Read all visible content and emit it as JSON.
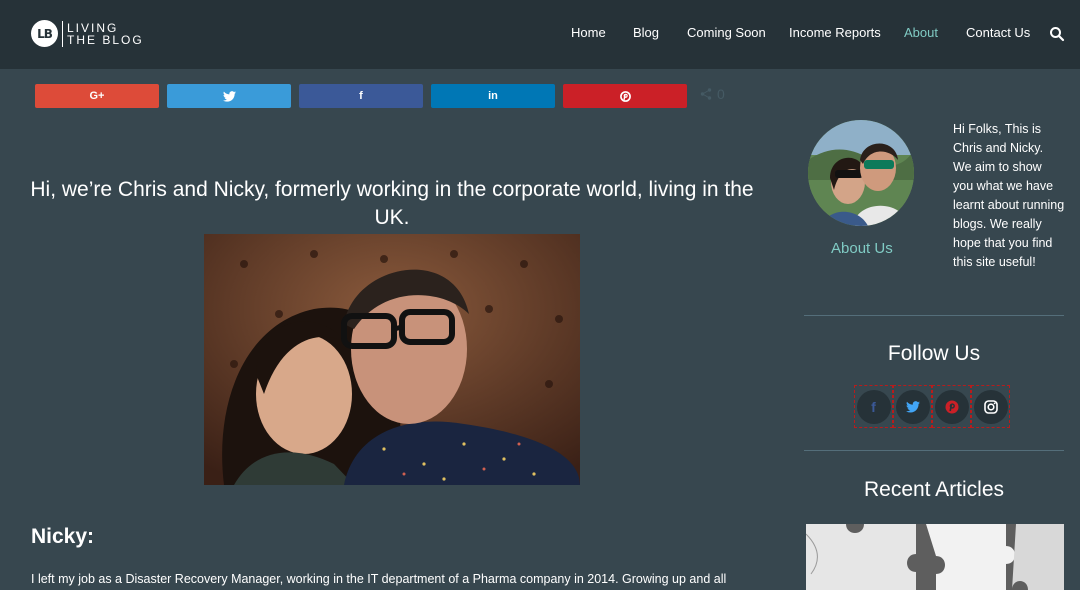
{
  "header": {
    "logo_badge": "LB",
    "logo_line1": "LIVING",
    "logo_line2": "THE BLOG",
    "nav": [
      {
        "label": "Home"
      },
      {
        "label": "Blog"
      },
      {
        "label": "Coming Soon"
      },
      {
        "label": "Income Reports"
      },
      {
        "label": "About"
      },
      {
        "label": "Contact Us"
      }
    ],
    "active_nav": "About",
    "search_icon": "search-icon"
  },
  "share": {
    "buttons": [
      {
        "network": "google-plus",
        "glyph": "G+",
        "color": "#dd4b39"
      },
      {
        "network": "twitter",
        "glyph": "twitter-icon",
        "color": "#3a9bd9"
      },
      {
        "network": "facebook",
        "glyph": "f",
        "color": "#3b5998"
      },
      {
        "network": "linkedin",
        "glyph": "in",
        "color": "#0077b5"
      },
      {
        "network": "pinterest",
        "glyph": "pinterest-icon",
        "color": "#cb2027"
      }
    ],
    "count": "0"
  },
  "main": {
    "intro": "Hi, we’re Chris and Nicky, formerly working in the corporate world, living in the UK.",
    "heading": "Nicky:",
    "paragraph": "I left my job as a Disaster Recovery Manager, working in the IT department of a Pharma company in 2014. Growing up and all"
  },
  "sidebar": {
    "about_link": "About Us",
    "about_text": "Hi Folks, This is Chris and Nicky. We aim to show you what we have learnt about running blogs.  We really hope that you find this site useful!",
    "follow_heading": "Follow Us",
    "social": [
      {
        "name": "facebook",
        "color": "#3b5998"
      },
      {
        "name": "twitter",
        "color": "#42a5f5"
      },
      {
        "name": "pinterest",
        "color": "#cb2027"
      },
      {
        "name": "instagram",
        "color": "#ffffff"
      }
    ],
    "recent_heading": "Recent Articles"
  },
  "colors": {
    "header_bg": "#263238",
    "page_bg": "#37474f",
    "accent": "#80cbc4"
  }
}
